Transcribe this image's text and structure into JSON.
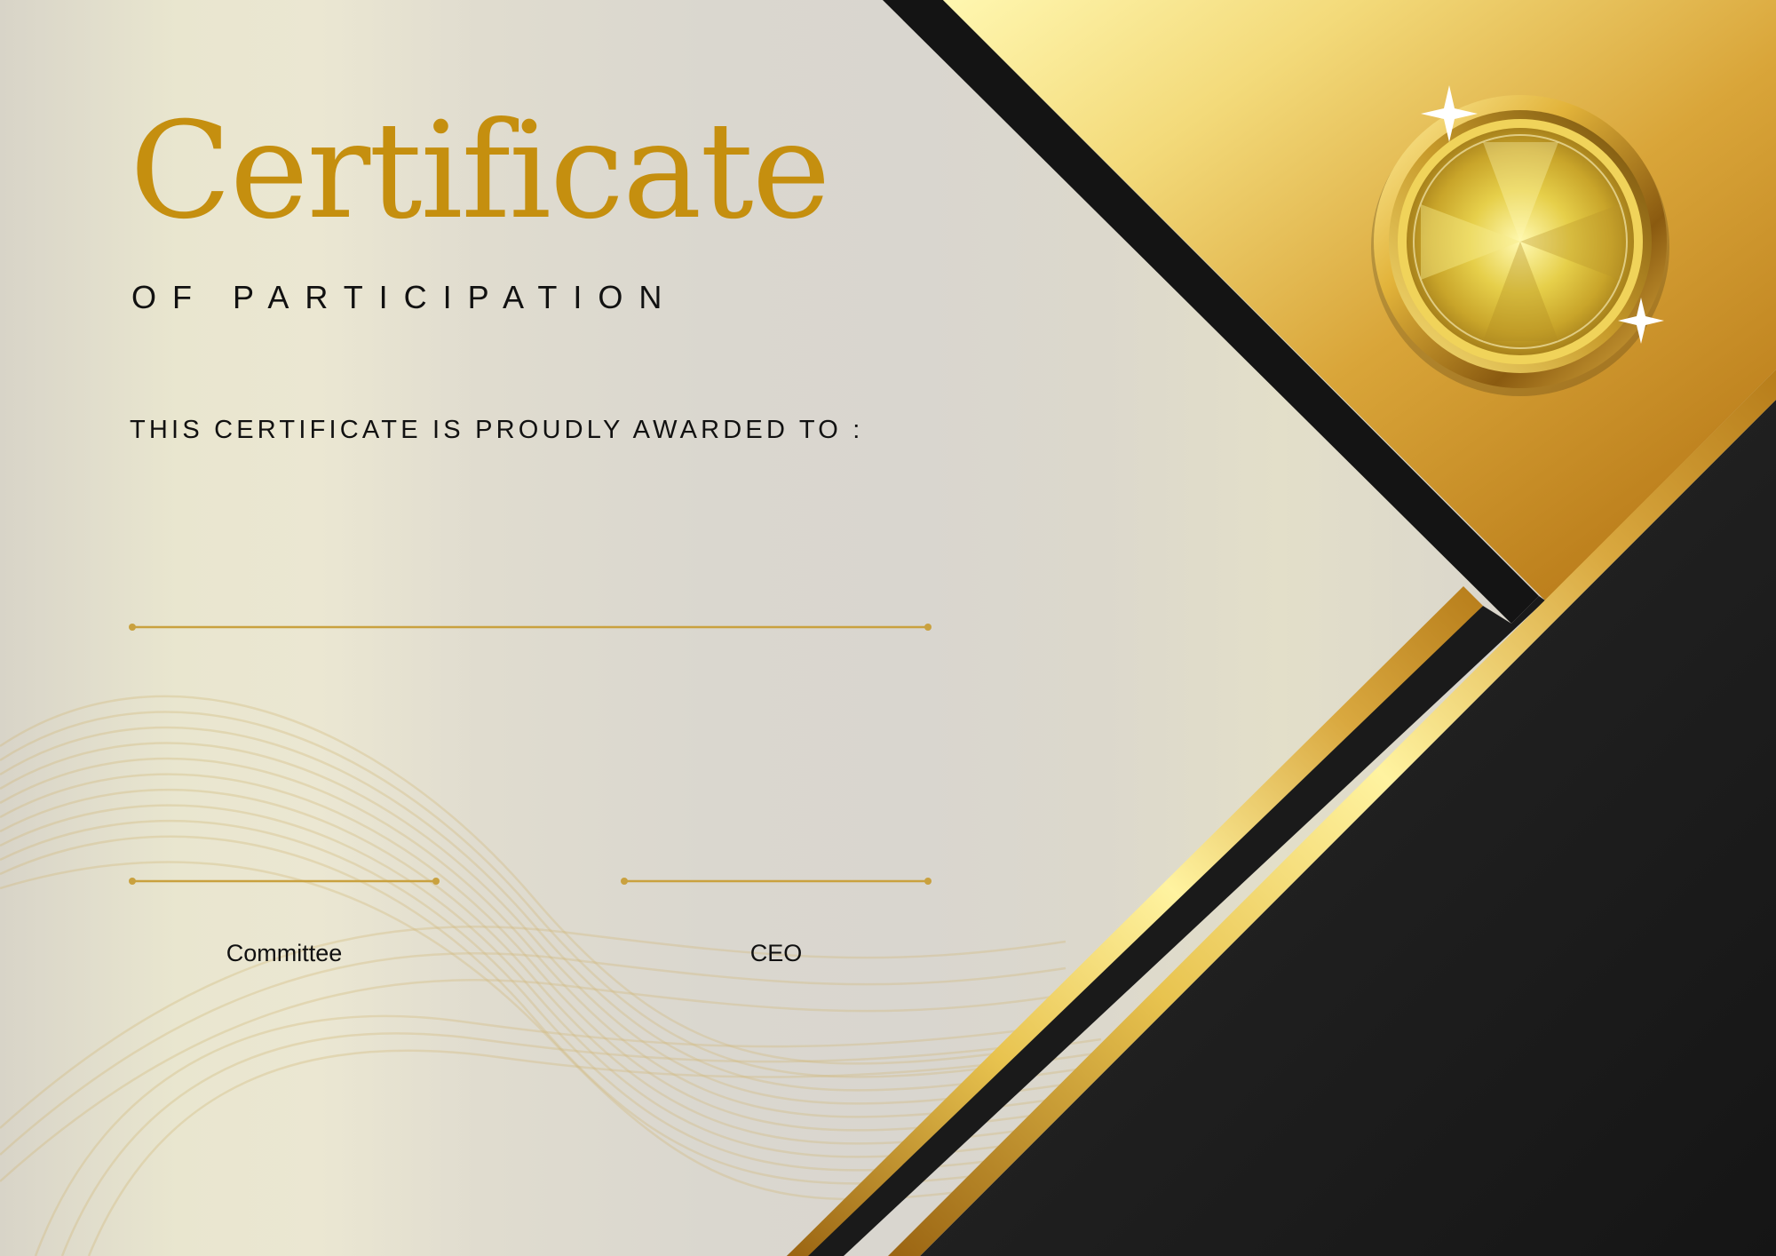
{
  "certificate": {
    "title": "Certificate",
    "subtitle": "OF PARTICIPATION",
    "awarded_text": "THIS CERTIFICATE IS PROUDLY AWARDED TO :",
    "recipient_name": "",
    "signatures": [
      {
        "label": "Committee"
      },
      {
        "label": "CEO"
      }
    ]
  },
  "colors": {
    "gold": "#c58f0f",
    "gold_light": "#fff29a",
    "gold_dark": "#b57b14",
    "black_panel": "#1d1d1d",
    "text": "#111111"
  },
  "icons": {
    "seal": "gold-medal-seal-icon",
    "sparkle": "sparkle-icon"
  }
}
